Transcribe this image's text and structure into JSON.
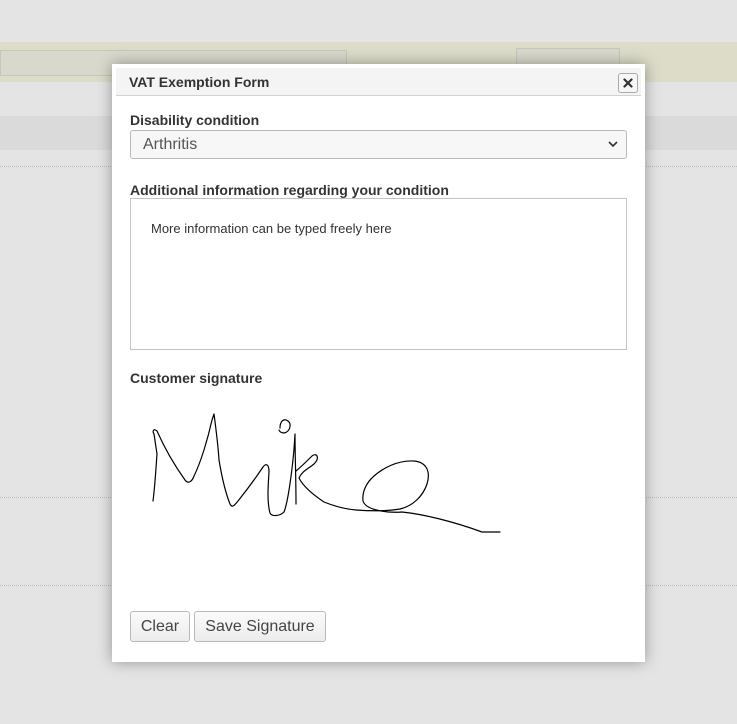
{
  "dialog": {
    "title": "VAT Exemption Form",
    "close_icon": "close-icon"
  },
  "form": {
    "condition_label": "Disability condition",
    "condition_value": "Arthritis",
    "info_label": "Additional information regarding your condition",
    "info_value": "More information can be typed freely here",
    "signature_label": "Customer signature"
  },
  "buttons": {
    "clear_label": "Clear",
    "save_label": "Save Signature"
  },
  "colors": {
    "backdrop": "#e4e4e4",
    "dialog_bg": "#ffffff",
    "signature_ink": "#000000"
  }
}
